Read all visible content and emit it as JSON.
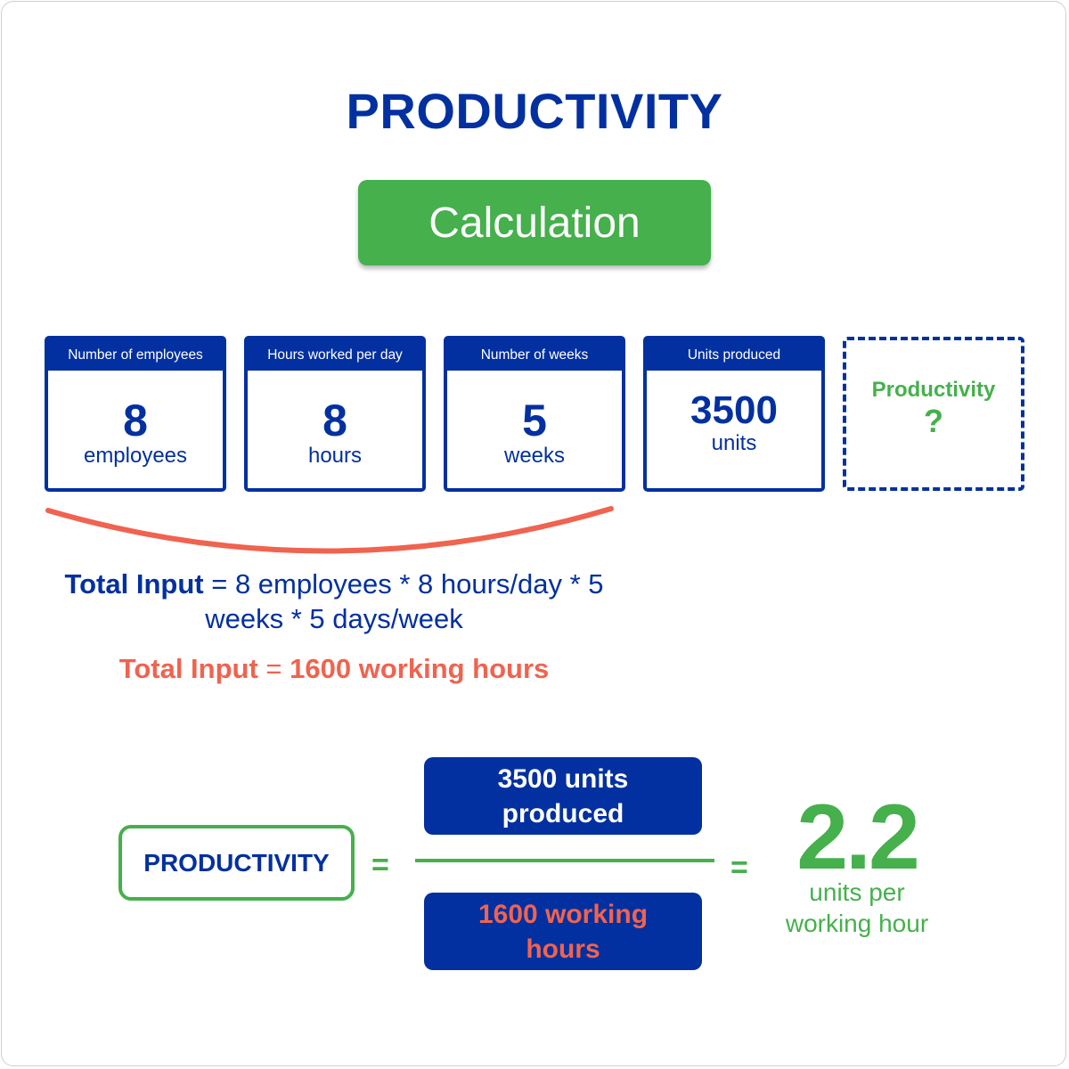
{
  "title": "PRODUCTIVITY",
  "calculation_label": "Calculation",
  "colors": {
    "primary_blue": "#0230a0",
    "green": "#45b04c",
    "coral": "#f0634f"
  },
  "cards": [
    {
      "header": "Number of employees",
      "value": "8",
      "unit": "employees"
    },
    {
      "header": "Hours worked per day",
      "value": "8",
      "unit": "hours"
    },
    {
      "header": "Number of weeks",
      "value": "5",
      "unit": "weeks"
    },
    {
      "header": "Units produced",
      "value": "3500",
      "unit": "units"
    }
  ],
  "unknown_card": {
    "label": "Productivity",
    "symbol": "?"
  },
  "total_input_formula": {
    "label": "Total Input",
    "equals": "=",
    "expression": "8 employees * 8 hours/day * 5 weeks * 5 days/week"
  },
  "total_input_result": {
    "label": "Total Input",
    "equals": "=",
    "value": "1600 working hours"
  },
  "equation": {
    "lhs": "PRODUCTIVITY",
    "equals": "=",
    "numerator": "3500 units produced",
    "denominator": "1600 working hours",
    "result": "2.2",
    "result_unit": "units per working hour"
  }
}
